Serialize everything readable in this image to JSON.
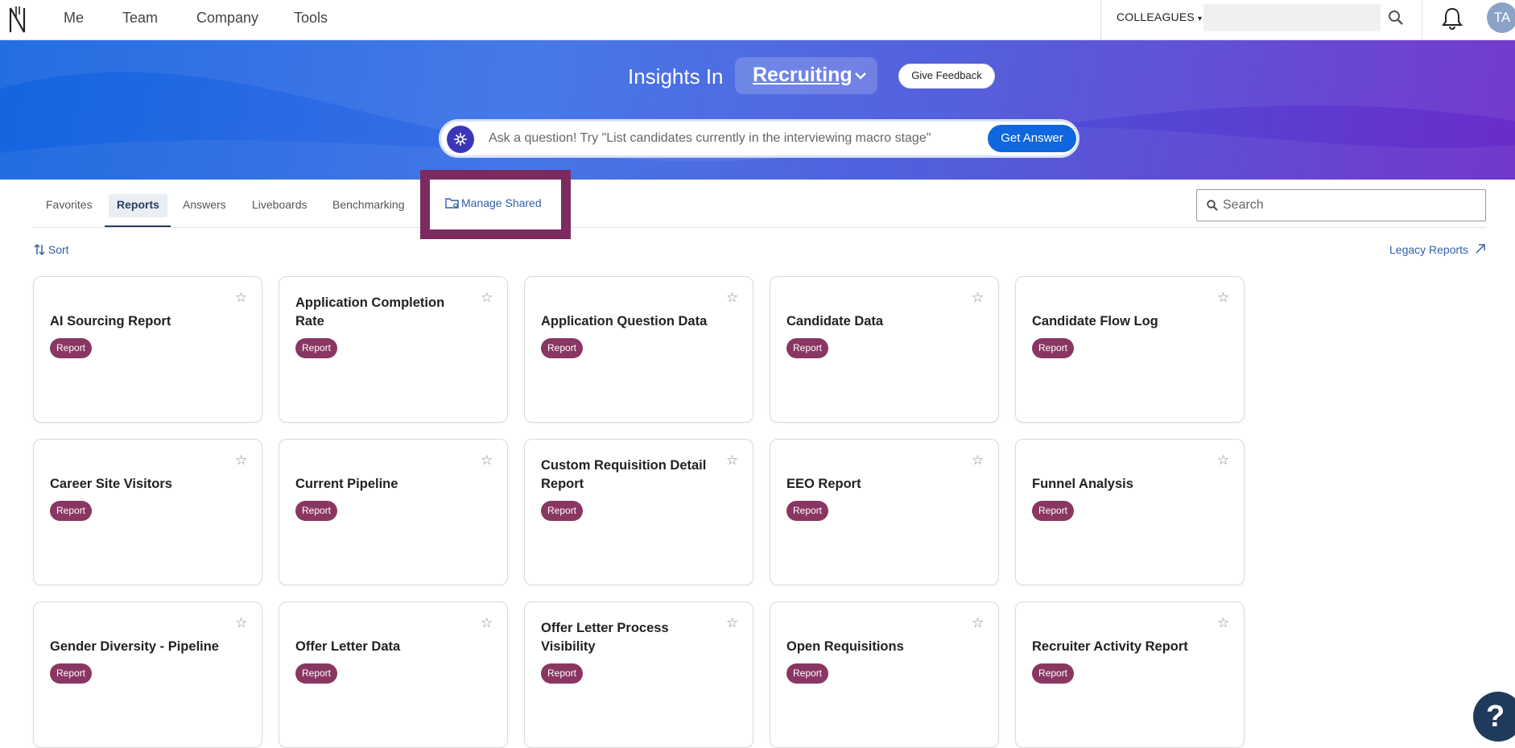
{
  "nav": {
    "items": [
      "Me",
      "Team",
      "Company",
      "Tools"
    ],
    "colleagues_label": "COLLEAGUES",
    "avatar_initials": "TA"
  },
  "hero": {
    "title": "Insights In",
    "module": "Recruiting",
    "feedback_label": "Give Feedback",
    "ask_placeholder": "Ask a question! Try \"List candidates currently in the interviewing macro stage\"",
    "ask_button": "Get Answer"
  },
  "tabs": {
    "items": [
      "Favorites",
      "Reports",
      "Answers",
      "Liveboards",
      "Benchmarking"
    ],
    "active": "Reports",
    "manage_shared": "Manage Shared",
    "search_placeholder": "Search"
  },
  "toolbar": {
    "sort_label": "Sort",
    "legacy_label": "Legacy Reports"
  },
  "cards": [
    {
      "title": "AI Sourcing Report",
      "badge": "Report"
    },
    {
      "title": "Application Completion Rate",
      "badge": "Report"
    },
    {
      "title": "Application Question Data",
      "badge": "Report"
    },
    {
      "title": "Candidate Data",
      "badge": "Report"
    },
    {
      "title": "Candidate Flow Log",
      "badge": "Report"
    },
    {
      "title": "Career Site Visitors",
      "badge": "Report"
    },
    {
      "title": "Current Pipeline",
      "badge": "Report"
    },
    {
      "title": "Custom Requisition Detail Report",
      "badge": "Report"
    },
    {
      "title": "EEO Report",
      "badge": "Report"
    },
    {
      "title": "Funnel Analysis",
      "badge": "Report"
    },
    {
      "title": "Gender Diversity - Pipeline",
      "badge": "Report"
    },
    {
      "title": "Offer Letter Data",
      "badge": "Report"
    },
    {
      "title": "Offer Letter Process Visibility",
      "badge": "Report"
    },
    {
      "title": "Open Requisitions",
      "badge": "Report"
    },
    {
      "title": "Recruiter Activity Report",
      "badge": "Report"
    }
  ],
  "help_label": "?",
  "colors": {
    "brand_blue": "#0f66de",
    "badge": "#8a3662",
    "highlight": "#7b2b5e",
    "link": "#2f5fa8"
  }
}
